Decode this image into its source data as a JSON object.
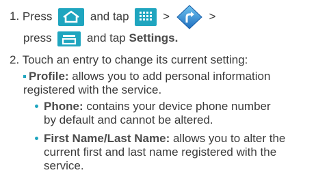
{
  "step1": {
    "number": "1.",
    "press_text": "Press",
    "tap_text": "and tap",
    "gt_1": ">",
    "gt_2": ">",
    "press2_text": "press",
    "and_tap_text": "and tap",
    "settings_label": "Settings."
  },
  "step2": {
    "number": "2.",
    "text": "Touch an entry to change its current setting:"
  },
  "profile": {
    "label": "Profile:",
    "text_line1": " allows you to add personal information",
    "text_line2": "registered with the service."
  },
  "phone": {
    "label": "Phone:",
    "text_line1": " contains your device phone number",
    "text_line2": "by default and cannot be altered."
  },
  "name": {
    "label": "First Name/Last Name:",
    "text_line1": " allows you to alter the",
    "text_line2": "current first and last name registered with the",
    "text_line3": "service."
  },
  "icons": {
    "home": "home-icon",
    "apps": "apps-grid-icon",
    "navigation": "navigation-app-icon",
    "menu": "menu-icon"
  },
  "colors": {
    "accent": "#1fa5bf",
    "text": "#3a3a3a"
  }
}
